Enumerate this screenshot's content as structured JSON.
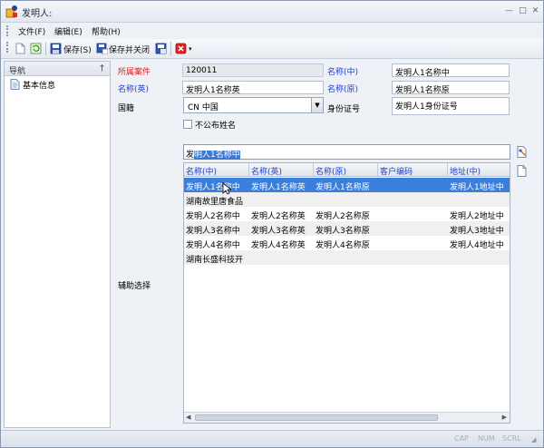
{
  "window": {
    "title": "发明人:"
  },
  "menu": [
    "文件(F)",
    "编辑(E)",
    "帮助(H)"
  ],
  "toolbar": {
    "save": "保存(S)",
    "save_close": "保存并关闭"
  },
  "nav": {
    "title": "导航",
    "item": "基本信息"
  },
  "form": {
    "case_label": "所属案件",
    "case_value": "120011",
    "name_cn_label": "名称(中)",
    "name_cn_value": "发明人1名称中",
    "name_en_label": "名称(英)",
    "name_en_value": "发明人1名称英",
    "name_orig_label": "名称(原)",
    "name_orig_value": "发明人1名称原",
    "nationality_label": "国籍",
    "nationality_value": "CN 中国",
    "id_label": "身份证号",
    "id_value": "发明人1身份证号",
    "hide_name_label": "不公布姓名",
    "assist_label": "辅助选择"
  },
  "search": {
    "prefix": "发",
    "selected": "明人1名称中"
  },
  "grid": {
    "columns": [
      "名称(中)",
      "名称(英)",
      "名称(原)",
      "客户编码",
      "地址(中)"
    ],
    "rows": [
      [
        "发明人1名称中",
        "发明人1名称英",
        "发明人1名称原",
        "",
        "发明人1地址中"
      ],
      [
        "湖南故里唐食品",
        "",
        "",
        "",
        ""
      ],
      [
        "发明人2名称中",
        "发明人2名称英",
        "发明人2名称原",
        "",
        "发明人2地址中"
      ],
      [
        "发明人3名称中",
        "发明人3名称英",
        "发明人3名称原",
        "",
        "发明人3地址中"
      ],
      [
        "发明人4名称中",
        "发明人4名称英",
        "发明人4名称原",
        "",
        "发明人4地址中"
      ],
      [
        "湖南长盛科技开",
        "",
        "",
        "",
        ""
      ]
    ]
  },
  "status": [
    "CAP",
    "NUM",
    "SCRL"
  ]
}
